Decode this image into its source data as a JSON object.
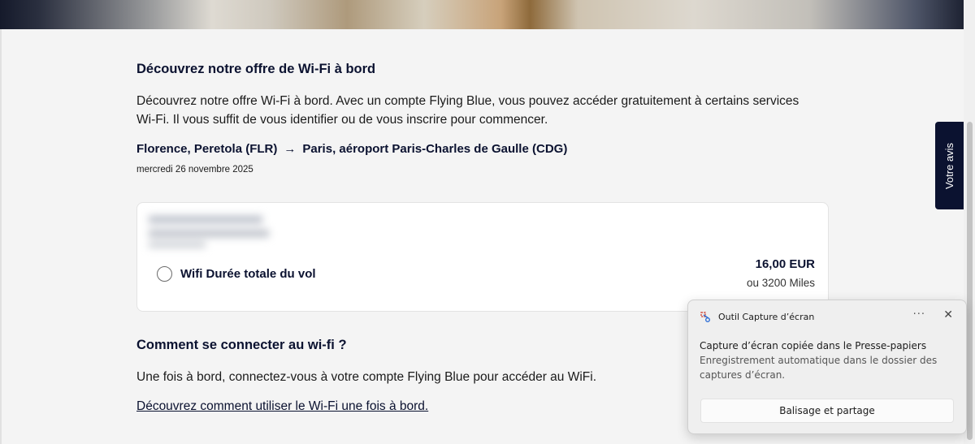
{
  "hero": {
    "image": "airplane-passenger-laptop-photo"
  },
  "wifi_section": {
    "title": "Découvrez notre offre de Wi-Fi à bord",
    "description": "Découvrez notre offre Wi-Fi à bord. Avec un compte Flying Blue, vous pouvez accéder gratuitement à certains services Wi-Fi. Il vous suffit de vous identifier ou de vous inscrire pour commencer.",
    "route": {
      "from": "Florence, Peretola (FLR)",
      "arrow": "→",
      "to": "Paris, aéroport Paris-Charles de Gaulle (CDG)"
    },
    "date": "mercredi 26 novembre 2025"
  },
  "offer": {
    "label": "Wifi Durée totale du vol",
    "price": "16,00 EUR",
    "miles": "ou 3200 Miles"
  },
  "connect_section": {
    "title": "Comment se connecter au wi-fi ?",
    "text": "Une fois à bord, connectez-vous à votre compte Flying Blue pour accéder au WiFi.",
    "link": "Découvrez comment utiliser le Wi-Fi une fois à bord."
  },
  "feedback_tab": {
    "label": "Votre avis"
  },
  "toast": {
    "app_name": "Outil Capture d’écran",
    "icon": "snipping-tool-icon",
    "more": "···",
    "close": "✕",
    "title": "Capture d’écran copiée dans le Presse-papiers",
    "body": "Enregistrement automatique dans le dossier des captures d’écran.",
    "button": "Balisage et partage"
  }
}
